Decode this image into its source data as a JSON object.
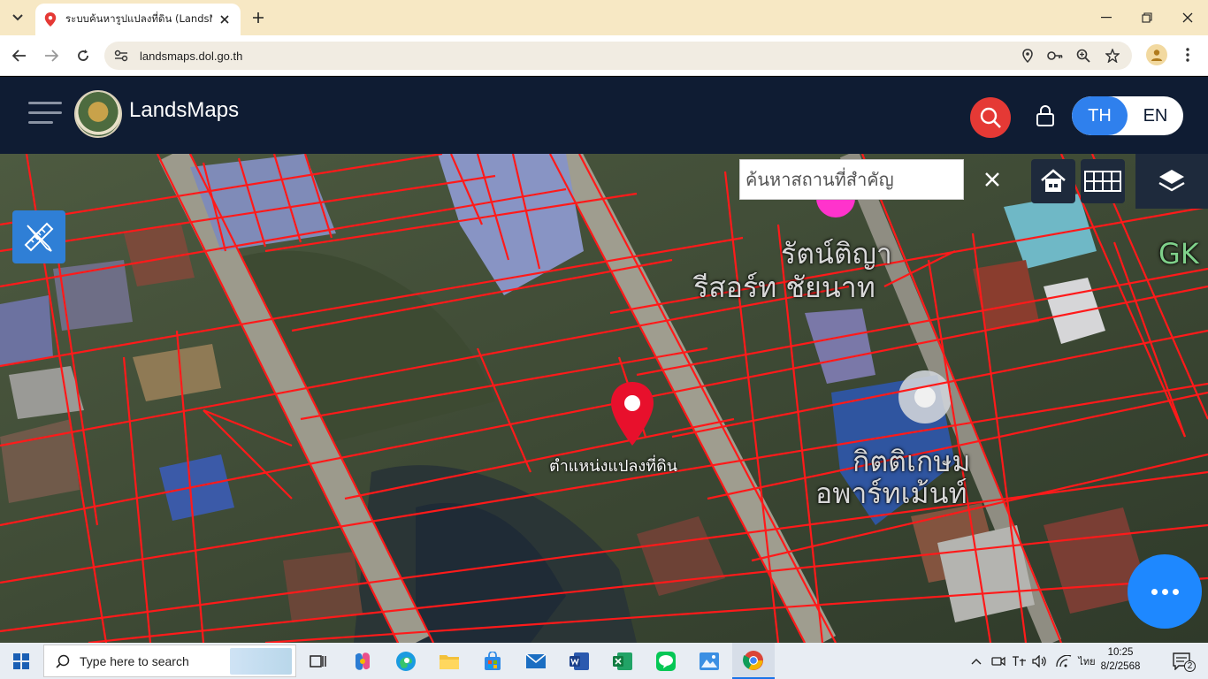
{
  "browser": {
    "tab_title": "ระบบค้นหารูปแปลงที่ดิน (LandsMaps)",
    "url": "landsmaps.dol.go.th",
    "colors": {
      "tabbar": "#f7e8c4",
      "omnibox": "#f1ece2"
    }
  },
  "header": {
    "brand": "LandsMaps",
    "lang_th": "TH",
    "lang_en": "EN",
    "active_lang": "TH",
    "colors": {
      "bg": "#0f1c33",
      "search": "#e53935",
      "accent": "#2f80ed"
    }
  },
  "map": {
    "search_placeholder": "ค้นหาสถานที่สำคัญ",
    "parcel_label": "ตำแหน่งแปลงที่ดิน",
    "poi_resort_line1": "รัตน์ติญา",
    "poi_resort_line2": "รีสอร์ท ชัยนาท",
    "poi_apartment_line1": "กิตติเกษม",
    "poi_apartment_line2": "อพาร์ทเม้นท์",
    "poi_edge": "GK",
    "colors": {
      "parcel_lines": "#ff1a1a",
      "fab": "#1e88ff",
      "tool": "#2f7fd6"
    },
    "icons": [
      "ruler-pencil-icon",
      "home-icon",
      "grid-icon",
      "layers-icon",
      "location-pin-icon",
      "more-icon"
    ]
  },
  "taskbar": {
    "search_placeholder": "Type here to search",
    "time": "10:25",
    "date": "8/2/2568",
    "lang": "ไทย",
    "notification_count": "2",
    "apps": [
      "task-view",
      "copilot",
      "edge",
      "file-explorer",
      "store",
      "mail",
      "word",
      "excel",
      "line",
      "photos",
      "chrome"
    ]
  }
}
